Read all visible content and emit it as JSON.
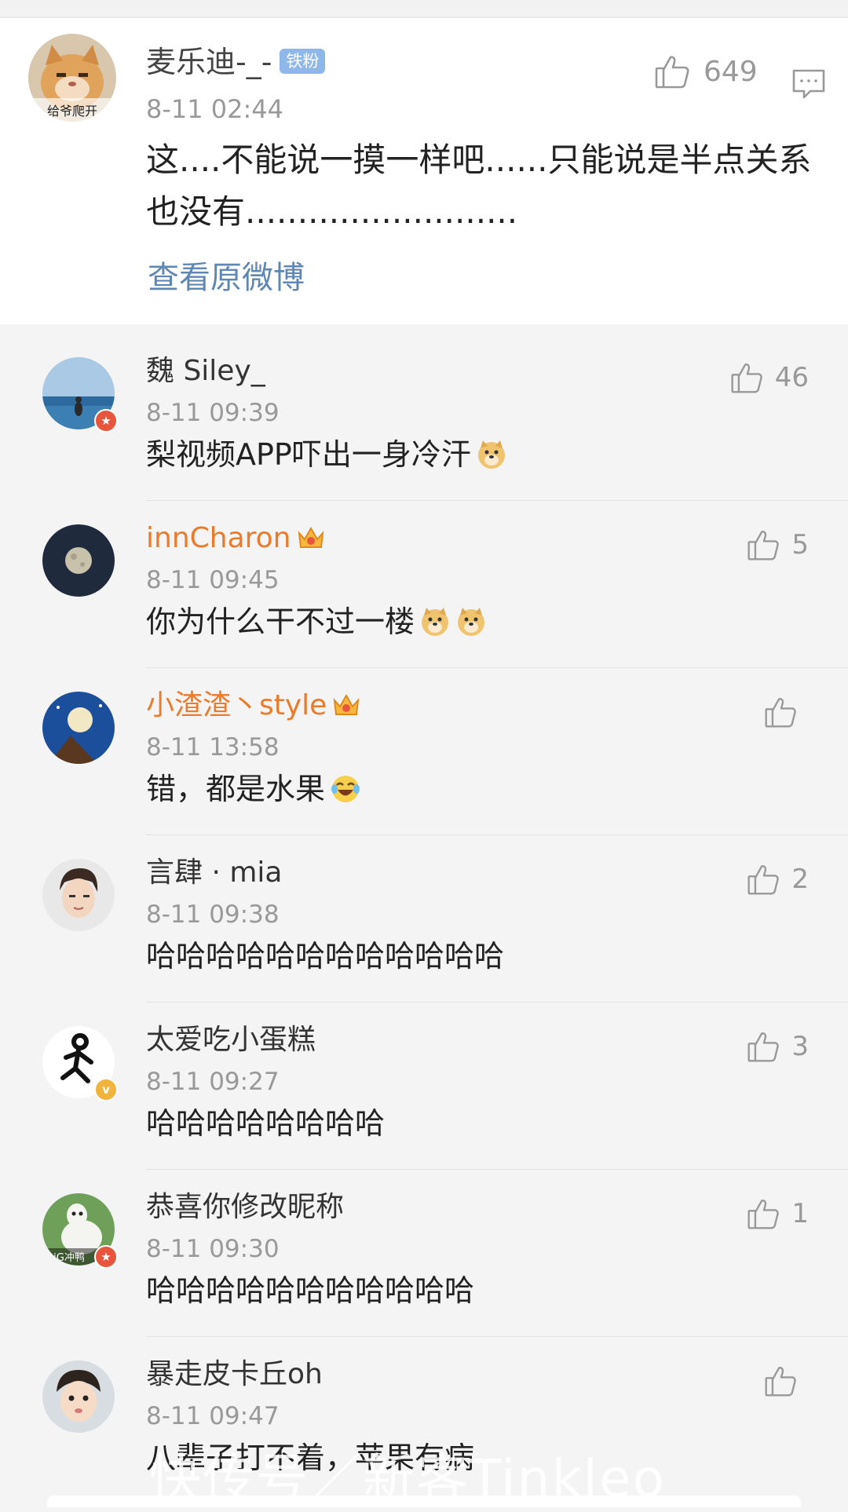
{
  "main_comment": {
    "username": "麦乐迪-_-",
    "badge": "铁粉",
    "timestamp": "8-11 02:44",
    "text": "这....不能说一摸一样吧......只能说是半点关系也没有..........................",
    "like_count": "649",
    "view_original_link": "查看原微博",
    "avatar_caption": "给爷爬开"
  },
  "comments": [
    {
      "username": "魏 Siley_",
      "timestamp": "8-11 09:39",
      "text": "梨视频APP吓出一身冷汗",
      "like_count": "46"
    },
    {
      "username": "innCharon",
      "timestamp": "8-11 09:45",
      "text": "你为什么干不过一楼",
      "like_count": "5"
    },
    {
      "username": "小渣渣丶style",
      "timestamp": "8-11 13:58",
      "text": "错，都是水果",
      "like_count": ""
    },
    {
      "username": "言肆 · mia",
      "timestamp": "8-11 09:38",
      "text": "哈哈哈哈哈哈哈哈哈哈哈哈",
      "like_count": "2"
    },
    {
      "username": "太爱吃小蛋糕",
      "timestamp": "8-11 09:27",
      "text": "哈哈哈哈哈哈哈哈",
      "like_count": "3"
    },
    {
      "username": "恭喜你修改昵称",
      "timestamp": "8-11 09:30",
      "text": "哈哈哈哈哈哈哈哈哈哈哈",
      "like_count": "1"
    },
    {
      "username": "暴走皮卡丘oh",
      "timestamp": "8-11 09:47",
      "text": "八辈子打不着，苹果有病",
      "like_count": ""
    }
  ],
  "avatar_texts": {
    "vip_v": "v",
    "star": "★",
    "ig": "iG冲鸭"
  },
  "watermark": "快传号／新客Tinkleo",
  "colors": {
    "link": "#5f87b3",
    "vip_name": "#eb7a2a",
    "badge": "#8fb8ea",
    "meta": "#999999"
  }
}
